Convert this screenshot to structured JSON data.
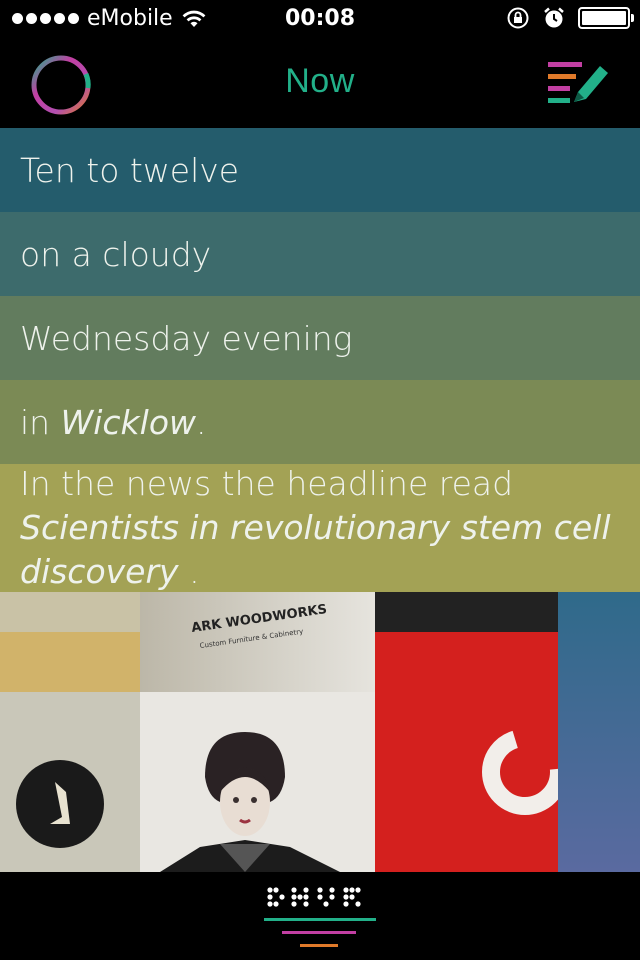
{
  "status_bar": {
    "carrier": "eMobile",
    "time": "00:08",
    "signal_bars": 5
  },
  "nav": {
    "title": "Now",
    "accent_color": "#22b089"
  },
  "story": {
    "line1": "Ten to twelve",
    "line2": "on a cloudy",
    "line3": "Wednesday evening",
    "line4_prefix": "in",
    "line4_place": "Wicklow",
    "line4_suffix": ".",
    "line5_prefix": "In the news the headline read",
    "line5_headline": "Scientists in revolutionary stem cell discovery",
    "line5_suffix": " ."
  },
  "photo": {
    "sign_text": "ARK WOODWORKS",
    "sign_subtext": "Custom Furniture & Cabinetry"
  },
  "colors": {
    "row1": "#245c6c",
    "row2": "#3d6b6c",
    "row3": "#627c5e",
    "row4": "#7b8a55",
    "row5": "#a3a255",
    "ring_magenta": "#c23fa3",
    "ring_green": "#22b089",
    "ring_orange": "#e07a2a"
  },
  "icons": {
    "left_nav": "ring-logo-icon",
    "right_nav": "compose-list-icon",
    "bottom": "save-braille-icon"
  }
}
